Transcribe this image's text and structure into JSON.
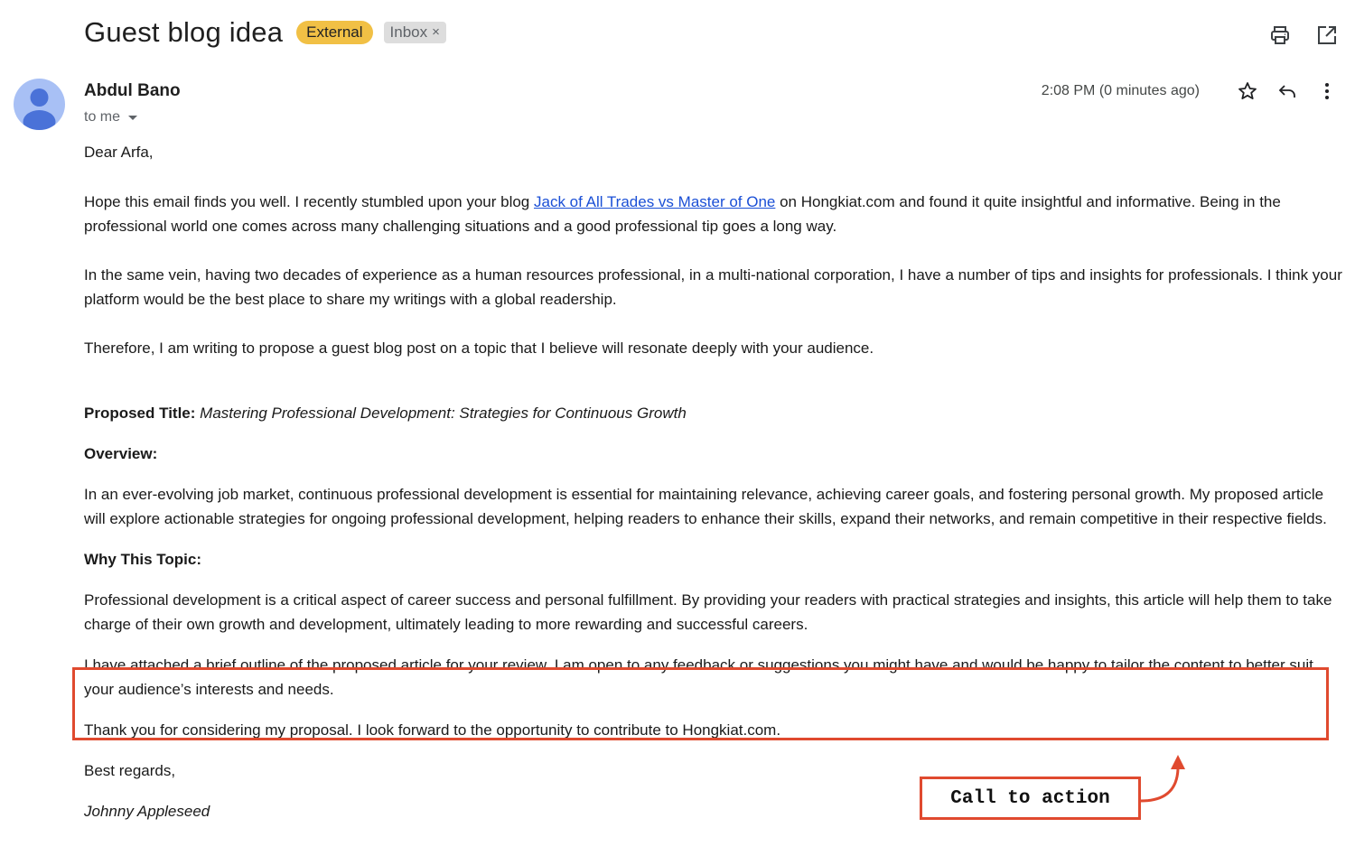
{
  "header": {
    "subject": "Guest blog idea",
    "labels": {
      "external": "External",
      "inbox": "Inbox",
      "inbox_remove": "×"
    },
    "icons": [
      "print-icon",
      "open-in-new-window-icon"
    ]
  },
  "message": {
    "sender_name": "Abdul Bano",
    "recipient": "to me",
    "timestamp": "2:08 PM (0 minutes ago)",
    "actions": [
      "star-icon",
      "reply-icon",
      "more-vert-icon"
    ],
    "body": {
      "greeting": "Dear Arfa,",
      "p1_before_link": "Hope this email finds you well. I recently stumbled upon your blog ",
      "p1_link": "Jack of All Trades vs Master of One",
      "p1_after_link": " on Hongkiat.com and found it quite insightful and informative. Being in the professional world one comes across many challenging situations and a good professional tip goes a long way.",
      "p2": "In the same vein, having two decades of experience as a human resources professional, in a multi-national corporation, I have a number of tips and insights for professionals. I think your platform would be the best place to share my writings with a global readership.",
      "p3": "Therefore, I am writing to propose a guest blog post on a topic that I believe will resonate deeply with your audience.",
      "proposed_title_label": "Proposed Title:",
      "proposed_title": "Mastering Professional Development: Strategies for Continuous Growth",
      "overview_heading": "Overview:",
      "overview": "In an ever-evolving job market, continuous professional development is essential for maintaining relevance, achieving career goals, and fostering personal growth. My proposed article will explore actionable strategies for ongoing professional development, helping readers to enhance their skills, expand their networks, and remain competitive in their respective fields.",
      "why_heading": "Why This Topic:",
      "why": "Professional development is a critical aspect of career success and personal fulfillment. By providing your readers with practical strategies and insights, this article will help them to take charge of their own growth and development, ultimately leading to more rewarding and successful careers.",
      "cta_paragraph": "I have attached a brief outline of the proposed article for your review. I am open to any feedback or suggestions you might have and would be happy to tailor the content to better suit your audience’s interests and needs.",
      "thanks": "Thank you for considering my proposal. I look forward to the opportunity to contribute to Hongkiat.com.",
      "closing": "Best regards,",
      "signature": "Johnny Appleseed"
    }
  },
  "annotation": {
    "label": "Call to action",
    "color": "#e04a2f"
  }
}
